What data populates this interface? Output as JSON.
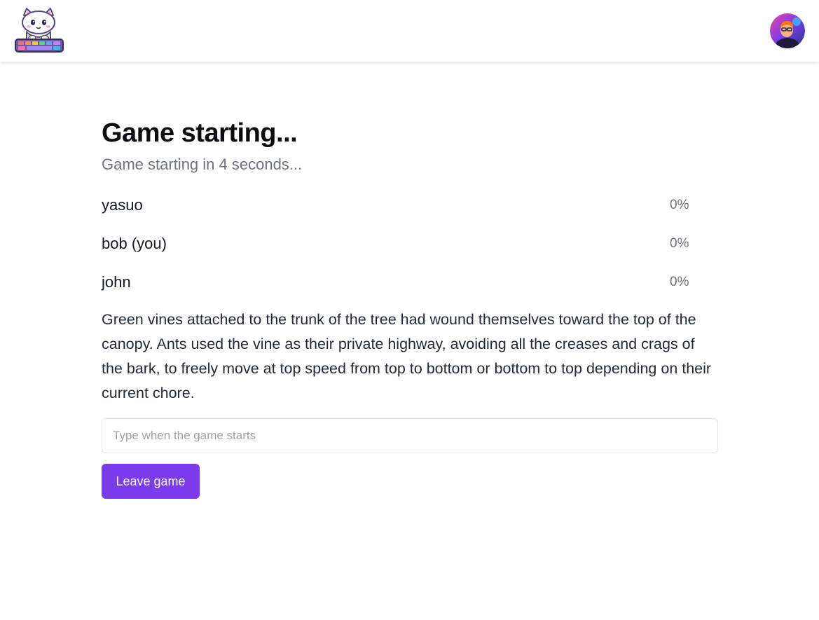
{
  "header": {
    "logo_icon": "cat-keyboard-logo-icon",
    "avatar_icon": "user-avatar-icon"
  },
  "main": {
    "title": "Game starting...",
    "subtitle": "Game starting in 4 seconds..."
  },
  "players": [
    {
      "name": "yasuo",
      "progress": "0%"
    },
    {
      "name": "bob (you)",
      "progress": "0%"
    },
    {
      "name": "john",
      "progress": "0%"
    }
  ],
  "passage": "Green vines attached to the trunk of the tree had wound themselves toward the top of the canopy. Ants used the vine as their private highway, avoiding all the creases and crags of the bark, to freely move at top speed from top to bottom or bottom to top depending on their current chore.",
  "input": {
    "value": "",
    "placeholder": "Type when the game starts"
  },
  "buttons": {
    "leave_label": "Leave game"
  },
  "colors": {
    "accent": "#7c3aed",
    "subtitle": "#6b7280",
    "heading": "#0b0b12"
  }
}
